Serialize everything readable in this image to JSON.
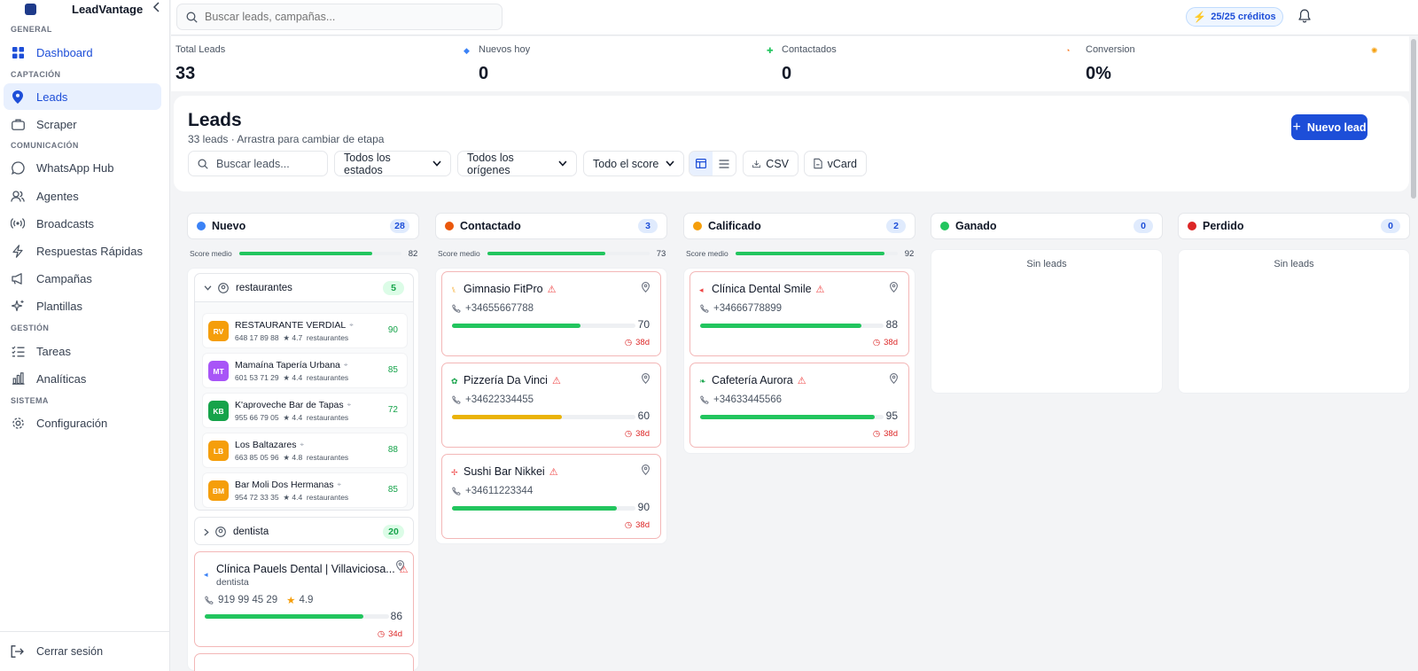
{
  "app": {
    "name": "LeadVantage"
  },
  "sidebar": {
    "sections": [
      {
        "label": "GENERAL"
      },
      {
        "label": "CAPTACIÓN"
      },
      {
        "label": "COMUNICACIÓN"
      },
      {
        "label": "GESTIÓN"
      },
      {
        "label": "SISTEMA"
      }
    ],
    "items": [
      {
        "label": "Dashboard",
        "icon": "grid-icon"
      },
      {
        "label": "Leads",
        "icon": "map-pin-icon"
      },
      {
        "label": "Scraper",
        "icon": "briefcase-icon"
      },
      {
        "label": "WhatsApp Hub",
        "icon": "chat-bubble-icon"
      },
      {
        "label": "Agentes",
        "icon": "users-icon"
      },
      {
        "label": "Broadcasts",
        "icon": "broadcast-icon"
      },
      {
        "label": "Respuestas Rápidas",
        "icon": "lightning-icon"
      },
      {
        "label": "Campañas",
        "icon": "megaphone-icon"
      },
      {
        "label": "Plantillas",
        "icon": "sparkle-icon"
      },
      {
        "label": "Tareas",
        "icon": "checklist-icon"
      },
      {
        "label": "Analíticas",
        "icon": "bar-chart-icon"
      },
      {
        "label": "Configuración",
        "icon": "gear-icon"
      }
    ],
    "logout": "Cerrar sesión"
  },
  "topbar": {
    "search_placeholder": "Buscar leads, campañas...",
    "credits": "25/25 créditos"
  },
  "stats": [
    {
      "label": "Total Leads",
      "value": "33"
    },
    {
      "label": "Nuevos hoy",
      "value": "0"
    },
    {
      "label": "Contactados",
      "value": "0"
    },
    {
      "label": "Conversion",
      "value": "0%"
    }
  ],
  "leads": {
    "title": "Leads",
    "subtitle": "33 leads · Arrastra para cambiar de etapa",
    "new_button": "Nuevo lead",
    "search_placeholder": "Buscar leads...",
    "filters": {
      "estado": "Todos los estados",
      "origen": "Todos los orígenes",
      "score": "Todo el score"
    },
    "export_csv": "CSV",
    "export_vcard": "vCard"
  },
  "kanban": {
    "score_label": "Score medio",
    "empty_label": "Sin leads",
    "columns": [
      {
        "name": "Nuevo",
        "count": "28",
        "color": "#3b82f6",
        "score": 82
      },
      {
        "name": "Contactado",
        "count": "3",
        "color": "#ea580c",
        "score": 73
      },
      {
        "name": "Calificado",
        "count": "2",
        "color": "#f59e0b",
        "score": 92
      },
      {
        "name": "Ganado",
        "count": "0",
        "color": "#22c55e"
      },
      {
        "name": "Perdido",
        "count": "0",
        "color": "#dc2626"
      }
    ],
    "nuevo": {
      "group_restaurantes": {
        "label": "restaurantes",
        "count": "5"
      },
      "restaurantes": [
        {
          "initials": "RV",
          "name": "RESTAURANTE VERDIAL",
          "phone": "648 17 89 88",
          "rating": "★ 4.7",
          "tag": "restaurantes",
          "score": "90",
          "color": "#f59e0b"
        },
        {
          "initials": "MT",
          "name": "Mamaína Tapería Urbana",
          "phone": "601 53 71 29",
          "rating": "★ 4.4",
          "tag": "restaurantes",
          "score": "85",
          "color": "#a855f7"
        },
        {
          "initials": "KB",
          "name": "K'aproveche Bar de Tapas",
          "phone": "955 66 79 05",
          "rating": "★ 4.4",
          "tag": "restaurantes",
          "score": "72",
          "color": "#16a34a"
        },
        {
          "initials": "LB",
          "name": "Los Baltazares",
          "phone": "663 85 05 96",
          "rating": "★ 4.8",
          "tag": "restaurantes",
          "score": "88",
          "color": "#f59e0b"
        },
        {
          "initials": "BM",
          "name": "Bar Moli Dos Hermanas",
          "phone": "954 72 33 35",
          "rating": "★ 4.4",
          "tag": "restaurantes",
          "score": "85",
          "color": "#f59e0b"
        }
      ],
      "group_dentista": {
        "label": "dentista",
        "count": "20"
      },
      "dentista_card": {
        "name": "Clínica Pauels Dental | Villaviciosa...",
        "category": "dentista",
        "phone": "919 99 45 29",
        "rating": "4.9",
        "score": 86,
        "age": "34d"
      }
    },
    "contactado": [
      {
        "name": "Gimnasio FitPro",
        "phone": "+34655667788",
        "score": 70,
        "age": "38d",
        "bar": "#22c55e"
      },
      {
        "name": "Pizzería Da Vinci",
        "phone": "+34622334455",
        "score": 60,
        "age": "38d",
        "bar": "#eab308"
      },
      {
        "name": "Sushi Bar Nikkei",
        "phone": "+34611223344",
        "score": 90,
        "age": "38d",
        "bar": "#22c55e"
      }
    ],
    "calificado": [
      {
        "name": "Clínica Dental Smile",
        "phone": "+34666778899",
        "score": 88,
        "age": "38d",
        "bar": "#22c55e"
      },
      {
        "name": "Cafetería Aurora",
        "phone": "+34633445566",
        "score": 95,
        "age": "38d",
        "bar": "#22c55e"
      }
    ]
  }
}
